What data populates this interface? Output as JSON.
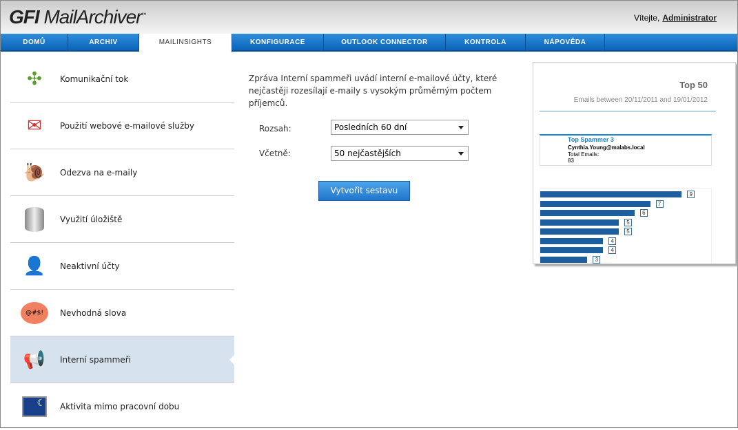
{
  "header": {
    "logo": "GFI MailArchiver",
    "welcome": "Vítejte,",
    "user": "Administrator"
  },
  "nav": [
    {
      "label": "DOMŮ"
    },
    {
      "label": "ARCHIV"
    },
    {
      "label": "MAILINSIGHTS",
      "active": true
    },
    {
      "label": "KONFIGURACE"
    },
    {
      "label": "OUTLOOK CONNECTOR"
    },
    {
      "label": "KONTROLA"
    },
    {
      "label": "NÁPOVĚDA"
    }
  ],
  "sidebar": {
    "items": [
      {
        "label": "Komunikační tok",
        "icon": "network-icon"
      },
      {
        "label": "Použití webové e-mailové služby",
        "icon": "webmail-icon"
      },
      {
        "label": "Odezva na e-maily",
        "icon": "snail-icon"
      },
      {
        "label": "Využití úložiště",
        "icon": "database-icon"
      },
      {
        "label": "Neaktivní účty",
        "icon": "user-icon"
      },
      {
        "label": "Nevhodná slova",
        "icon": "speech-bubble-icon"
      },
      {
        "label": "Interní spammeři",
        "icon": "megaphone-icon",
        "active": true
      },
      {
        "label": "Aktivita mimo pracovní dobu",
        "icon": "night-monitor-icon"
      }
    ]
  },
  "main": {
    "description": "Zpráva Interní spammeři uvádí interní e-mailové účty, které nejčastěji rozesílají e-maily s vysokým průměrným počtem příjemců.",
    "range_label": "Rozsah:",
    "range_value": "Posledních 60 dní",
    "include_label": "Včetně:",
    "include_value": "50 nejčastějších",
    "generate_button": "Vytvořit sestavu"
  },
  "preview": {
    "title": "Top 50",
    "subtitle": "Emails between 20/11/2011 and 19/01/2012",
    "card_title": "Top Spammer 3",
    "card_email": "Cynthia.Young@malabs.local",
    "card_total_label": "Total Emails:",
    "card_total": "83",
    "bars": [
      9,
      7,
      6,
      5,
      5,
      4,
      4,
      3
    ]
  },
  "colors": {
    "nav": "#1a78cc",
    "active_item": "#d6e3ef",
    "bar": "#1d5f9e"
  }
}
